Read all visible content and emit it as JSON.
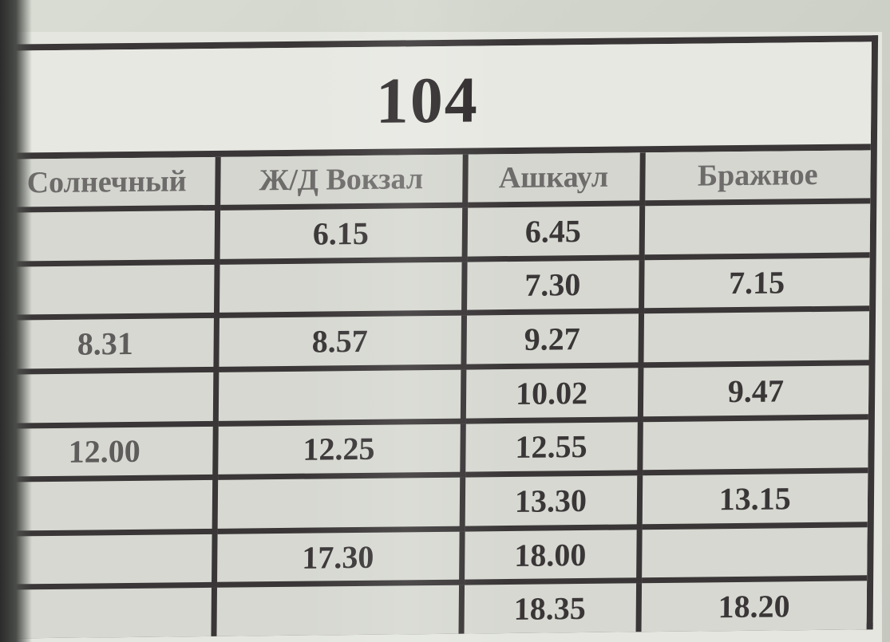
{
  "route": {
    "number": "104"
  },
  "columns": [
    "Солнечный",
    "Ж/Д Вокзал",
    "Ашкаул",
    "Бражное"
  ],
  "rows": [
    [
      "",
      "6.15",
      "6.45",
      ""
    ],
    [
      "",
      "",
      "7.30",
      "7.15"
    ],
    [
      "8.31",
      "8.57",
      "9.27",
      ""
    ],
    [
      "",
      "",
      "10.02",
      "9.47"
    ],
    [
      "12.00",
      "12.25",
      "12.55",
      ""
    ],
    [
      "",
      "",
      "13.30",
      "13.15"
    ],
    [
      "",
      "17.30",
      "18.00",
      ""
    ],
    [
      "",
      "",
      "18.35",
      "18.20"
    ]
  ],
  "colors": {
    "ink": "#3a3637",
    "paper": "#d6d8d1",
    "header_text": "#6e6b6b"
  }
}
